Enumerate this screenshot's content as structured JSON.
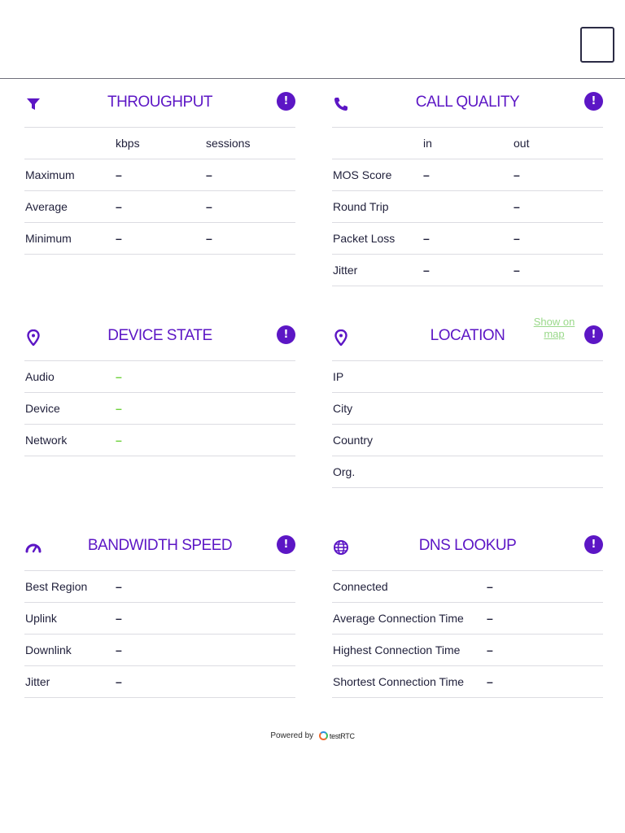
{
  "menu": {
    "icon": "square-menu-icon"
  },
  "throughput": {
    "title": "THROUGHPUT",
    "icon": "filter-icon",
    "alert": "!",
    "headers": [
      "kbps",
      "sessions"
    ],
    "rows": [
      {
        "label": "Maximum",
        "v1": "–",
        "v2": "–"
      },
      {
        "label": "Average",
        "v1": "–",
        "v2": "–"
      },
      {
        "label": "Minimum",
        "v1": "–",
        "v2": "–"
      }
    ]
  },
  "call_quality": {
    "title": "CALL QUALITY",
    "icon": "phone-icon",
    "alert": "!",
    "headers": [
      "in",
      "out"
    ],
    "rows": [
      {
        "label": "MOS Score",
        "v1": "–",
        "v2": "–"
      },
      {
        "label": "Round Trip",
        "v1": "",
        "v2": "–"
      },
      {
        "label": "Packet Loss",
        "v1": "–",
        "v2": "–"
      },
      {
        "label": "Jitter",
        "v1": "–",
        "v2": "–"
      }
    ]
  },
  "device_state": {
    "title": "DEVICE STATE",
    "icon": "location-pin-icon",
    "alert": "!",
    "rows": [
      {
        "label": "Audio",
        "value": "–"
      },
      {
        "label": "Device",
        "value": "–"
      },
      {
        "label": "Network",
        "value": "–"
      }
    ]
  },
  "location": {
    "title": "LOCATION",
    "icon": "location-pin-icon",
    "alert": "!",
    "map_link": "Show on map",
    "rows": [
      {
        "label": "IP"
      },
      {
        "label": "City"
      },
      {
        "label": "Country"
      },
      {
        "label": "Org."
      }
    ]
  },
  "bandwidth": {
    "title": "BANDWIDTH SPEED",
    "icon": "speedometer-icon",
    "alert": "!",
    "rows": [
      {
        "label": "Best Region",
        "value": "–"
      },
      {
        "label": "Uplink",
        "value": "–"
      },
      {
        "label": "Downlink",
        "value": "–"
      },
      {
        "label": "Jitter",
        "value": "–"
      }
    ]
  },
  "dns": {
    "title": "DNS LOOKUP",
    "icon": "globe-icon",
    "alert": "!",
    "rows": [
      {
        "label": "Connected",
        "value": "–"
      },
      {
        "label": "Average Connection Time",
        "value": "–"
      },
      {
        "label": "Highest Connection Time",
        "value": "–"
      },
      {
        "label": "Shortest Connection Time",
        "value": "–"
      }
    ]
  },
  "footer": {
    "powered_by": "Powered by",
    "brand": "testRTC"
  },
  "colors": {
    "accent": "#5c16c5",
    "ok": "#6ed23c",
    "link": "#9bd98b"
  }
}
